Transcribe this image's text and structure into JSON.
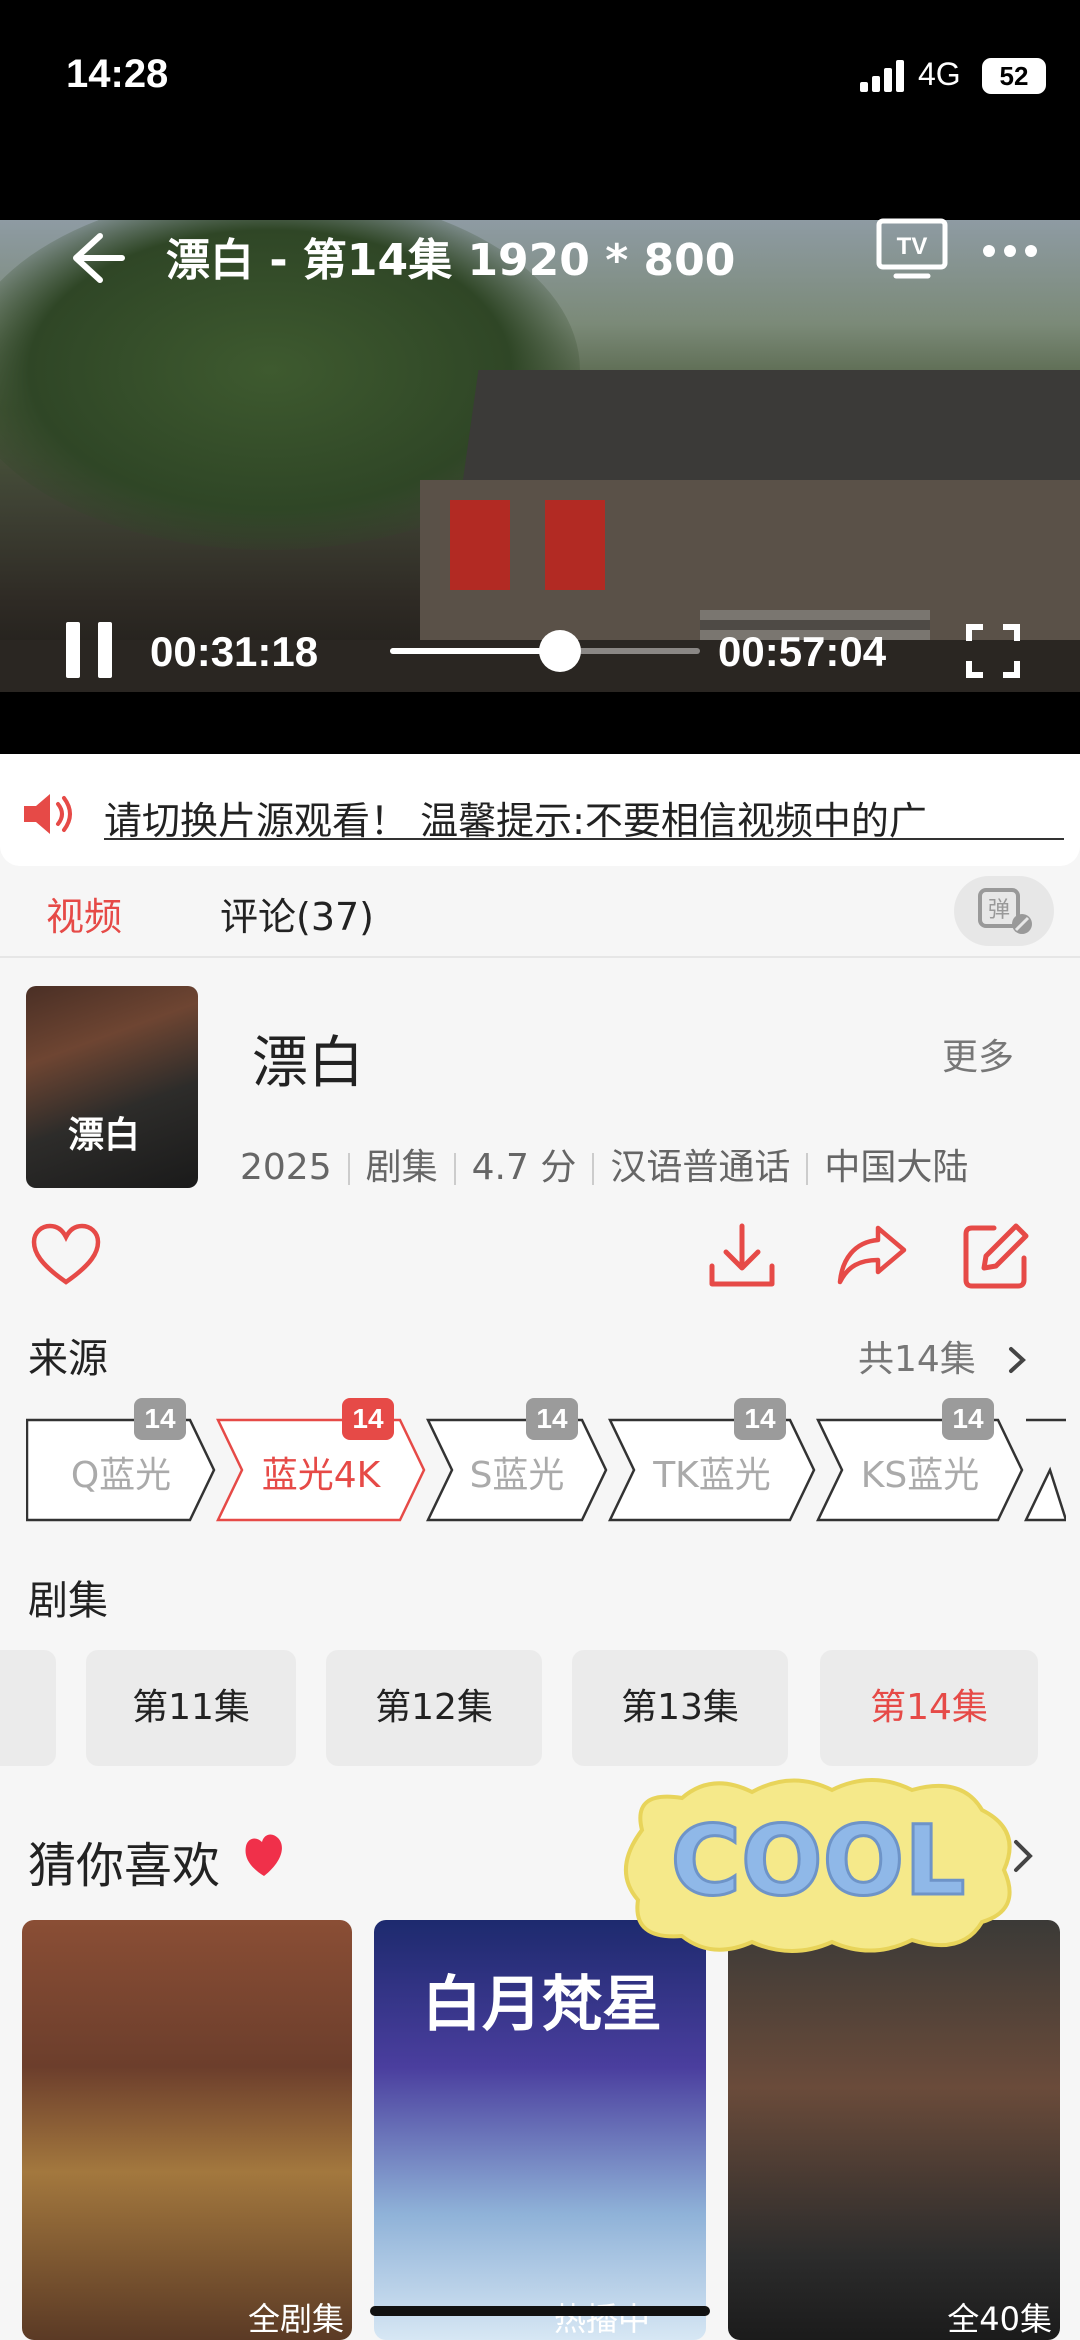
{
  "status_bar": {
    "time": "14:28",
    "network": "4G",
    "battery": "52"
  },
  "player": {
    "title": "漂白 - 第14集 1920 * 800",
    "current_time": "00:31:18",
    "total_time": "00:57:04",
    "progress": 0.548
  },
  "notice": {
    "text": "请切换片源观看！        温馨提示:不要相信视频中的广"
  },
  "tabs": {
    "video": "视频",
    "comments": "评论(37)",
    "danmu_label": "弹"
  },
  "info": {
    "poster_title": "漂白",
    "title": "漂白",
    "more": "更多",
    "meta": [
      "2025",
      "剧集",
      "4.7 分",
      "汉语普通话",
      "中国大陆"
    ]
  },
  "sources": {
    "heading": "来源",
    "total": "共14集",
    "items": [
      {
        "label": "Q蓝光",
        "count": "14",
        "active": false
      },
      {
        "label": "蓝光4K",
        "count": "14",
        "active": true
      },
      {
        "label": "S蓝光",
        "count": "14",
        "active": false
      },
      {
        "label": "TK蓝光",
        "count": "14",
        "active": false
      },
      {
        "label": "KS蓝光",
        "count": "14",
        "active": false
      }
    ]
  },
  "episodes": {
    "heading": "剧集",
    "items": [
      "第11集",
      "第12集",
      "第13集",
      "第14集"
    ],
    "selected": "第14集"
  },
  "recommend": {
    "heading": "猜你喜欢",
    "sticker_text": "COOL",
    "cards": [
      {
        "tag": "全剧集"
      },
      {
        "title": "白月梵星",
        "tag": "热播中"
      },
      {
        "tag": "全40集"
      }
    ]
  },
  "colors": {
    "accent": "#e64a47",
    "background": "#f6f6f6"
  }
}
